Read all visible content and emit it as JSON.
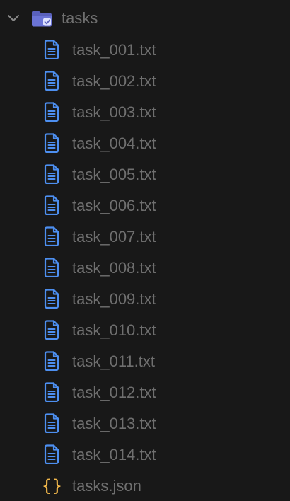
{
  "explorer": {
    "folder": {
      "name": "tasks",
      "expanded": true,
      "icon": "folder-check-icon",
      "chevron_icon": "chevron-down-icon",
      "accent_color": "#6b74d6"
    },
    "files": [
      {
        "name": "task_001.txt",
        "icon": "text-file-icon"
      },
      {
        "name": "task_002.txt",
        "icon": "text-file-icon"
      },
      {
        "name": "task_003.txt",
        "icon": "text-file-icon"
      },
      {
        "name": "task_004.txt",
        "icon": "text-file-icon"
      },
      {
        "name": "task_005.txt",
        "icon": "text-file-icon"
      },
      {
        "name": "task_006.txt",
        "icon": "text-file-icon"
      },
      {
        "name": "task_007.txt",
        "icon": "text-file-icon"
      },
      {
        "name": "task_008.txt",
        "icon": "text-file-icon"
      },
      {
        "name": "task_009.txt",
        "icon": "text-file-icon"
      },
      {
        "name": "task_010.txt",
        "icon": "text-file-icon"
      },
      {
        "name": "task_011.txt",
        "icon": "text-file-icon"
      },
      {
        "name": "task_012.txt",
        "icon": "text-file-icon"
      },
      {
        "name": "task_013.txt",
        "icon": "text-file-icon"
      },
      {
        "name": "task_014.txt",
        "icon": "text-file-icon"
      },
      {
        "name": "tasks.json",
        "icon": "json-braces-icon",
        "glyph": "{}"
      }
    ],
    "colors": {
      "background": "#181818",
      "text": "#6f6f6f",
      "file_icon": "#4d8ff0",
      "json_icon": "#f2b84b",
      "folder_icon": "#6b74d6"
    }
  }
}
